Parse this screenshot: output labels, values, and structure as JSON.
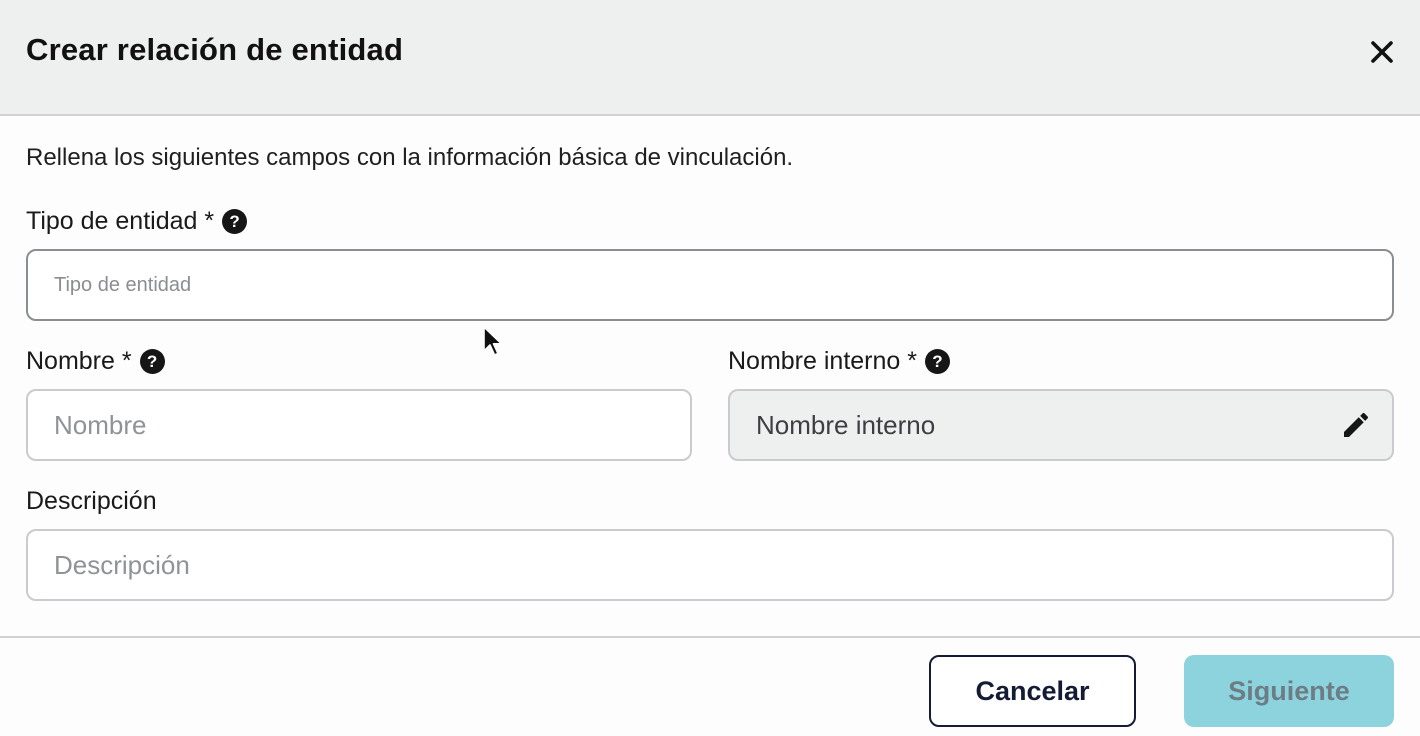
{
  "dialog": {
    "title": "Crear relación de entidad",
    "close_label": "×",
    "intro": "Rellena los siguientes campos con la información básica de vinculación."
  },
  "fields": {
    "entity_type": {
      "label": "Tipo de entidad *",
      "placeholder": "Tipo de entidad",
      "value": "",
      "help_icon": "question-circle-icon"
    },
    "name": {
      "label": "Nombre *",
      "placeholder": "Nombre",
      "value": "",
      "help_icon": "question-circle-icon"
    },
    "internal_name": {
      "label": "Nombre interno *",
      "placeholder": "Nombre interno",
      "value": "",
      "help_icon": "question-circle-icon",
      "edit_icon": "pencil-icon",
      "disabled": true
    },
    "description": {
      "label": "Descripción",
      "placeholder": "Descripción",
      "value": ""
    }
  },
  "help_glyph": "?",
  "actions": {
    "cancel_label": "Cancelar",
    "next_label": "Siguiente",
    "next_disabled": true
  },
  "colors": {
    "header_bg": "#eeefef",
    "primary_disabled": "#8dd3dd",
    "cancel_border": "#141b34"
  }
}
